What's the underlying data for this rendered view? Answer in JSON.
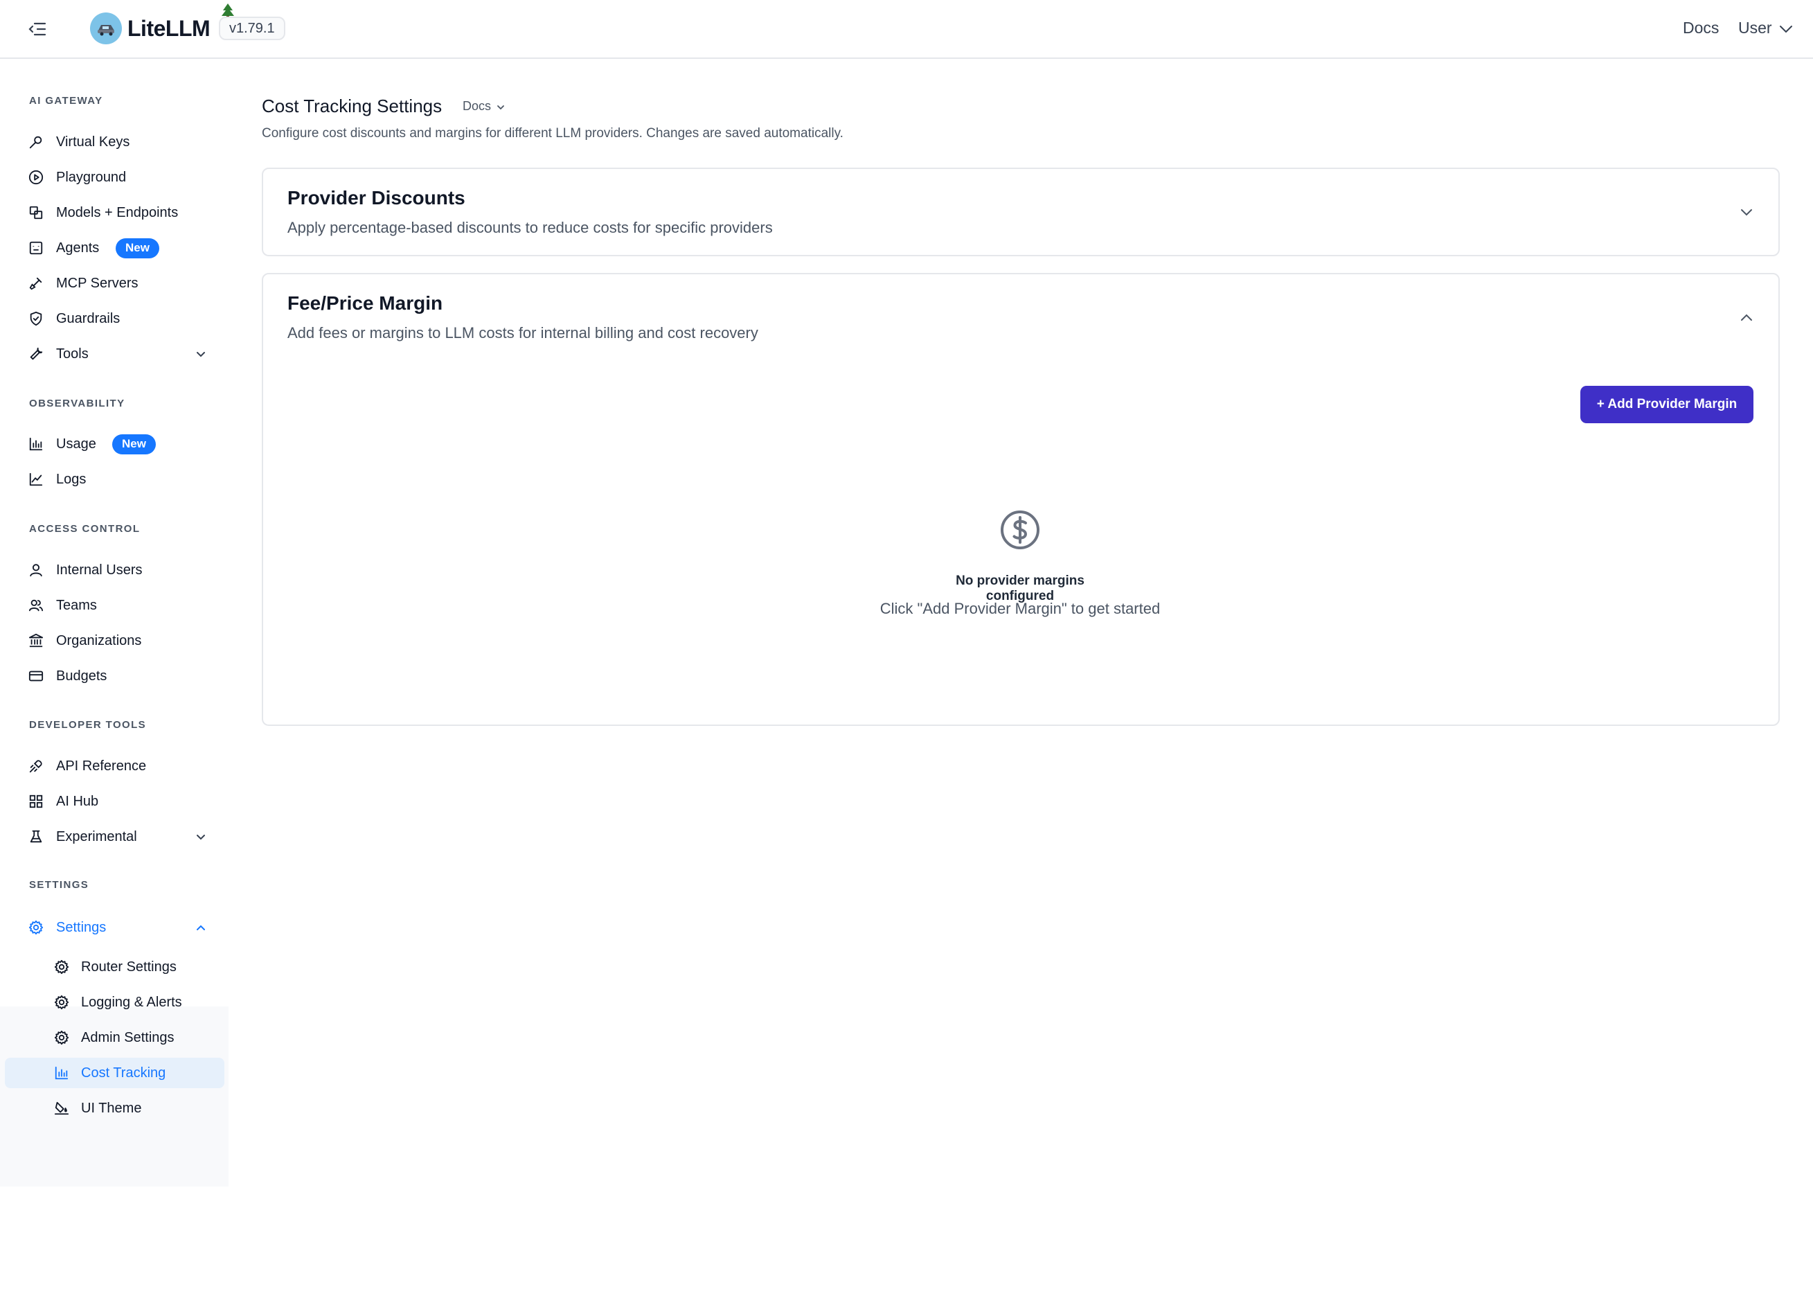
{
  "topbar": {
    "app_name": "LiteLLM",
    "version": "v1.79.1",
    "docs_label": "Docs",
    "user_label": "User"
  },
  "sidebar": {
    "sections": {
      "ai_gateway": "AI GATEWAY",
      "observability": "OBSERVABILITY",
      "access_control": "ACCESS CONTROL",
      "developer_tools": "DEVELOPER TOOLS",
      "settings": "SETTINGS"
    },
    "items": {
      "virtual_keys": "Virtual Keys",
      "playground": "Playground",
      "models_endpoints": "Models + Endpoints",
      "agents": "Agents",
      "mcp_servers": "MCP Servers",
      "guardrails": "Guardrails",
      "tools": "Tools",
      "usage": "Usage",
      "logs": "Logs",
      "internal_users": "Internal Users",
      "teams": "Teams",
      "organizations": "Organizations",
      "budgets": "Budgets",
      "api_reference": "API Reference",
      "ai_hub": "AI Hub",
      "experimental": "Experimental",
      "settings": "Settings"
    },
    "badges": {
      "agents": "New",
      "usage": "New"
    },
    "settings_submenu": {
      "router_settings": "Router Settings",
      "logging_alerts": "Logging & Alerts",
      "admin_settings": "Admin Settings",
      "cost_tracking": "Cost Tracking",
      "ui_theme": "UI Theme"
    }
  },
  "main": {
    "title": "Cost Tracking Settings",
    "docs_label": "Docs",
    "description": "Configure cost discounts and margins for different LLM providers. Changes are saved automatically.",
    "provider_discounts": {
      "title": "Provider Discounts",
      "subtitle": "Apply percentage-based discounts to reduce costs for specific providers",
      "expanded": false
    },
    "fee_margin": {
      "title": "Fee/Price Margin",
      "subtitle": "Add fees or margins to LLM costs for internal billing and cost recovery",
      "expanded": true,
      "add_button": "+ Add Provider Margin",
      "empty_title": "No provider margins configured",
      "empty_subtitle": "Click \"Add Provider Margin\" to get started",
      "empty_icon": "dollar-circle-icon"
    }
  },
  "colors": {
    "accent_blue": "#1677ff",
    "primary_button": "#3f2fc7",
    "selected_bg": "#e6f0fb"
  }
}
